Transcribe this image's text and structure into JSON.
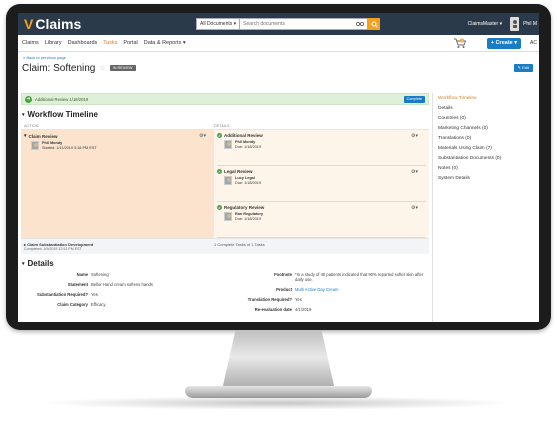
{
  "app": {
    "title": "Claims"
  },
  "search": {
    "scope": "All Documents ▾",
    "placeholder": "Search documents"
  },
  "user": {
    "name": "ClaimsMaster ▾",
    "short": "Phil M"
  },
  "nav": {
    "items": [
      "Claims",
      "Library",
      "Dashboards",
      "Tasks",
      "Portal",
      "Data & Reports ▾"
    ],
    "active_index": 3,
    "create_label": "+ Create ▾",
    "more": "AC",
    "cart_count": "0"
  },
  "page": {
    "back_link": "« Back to previous page",
    "title": "Claim: Softening",
    "star": "☆",
    "status": "IN REVIEW",
    "edit_label": "✎ Edit"
  },
  "alert": {
    "text": "Additional Review 1/18/2019",
    "button": "Complete"
  },
  "workflow": {
    "title": "Workflow Timeline",
    "columns": [
      "ACTION",
      "DETAILS"
    ],
    "action": {
      "title": "Claim Review",
      "person": "Phil Mondy",
      "meta": "Started: 1/11/2019 3:18 PM EST"
    },
    "tasks": [
      {
        "title": "Additional Review",
        "person": "Phil Mondy",
        "due": "Due: 1/18/2019"
      },
      {
        "title": "Legal Review",
        "person": "Lucy Legal",
        "due": "Due: 1/18/2019"
      },
      {
        "title": "Regulatory Review",
        "person": "Ran Regulatory",
        "due": "Due: 1/18/2019"
      }
    ],
    "substantiation": {
      "title": "▸ Claim Substantiation Development",
      "meta": "Completed: 1/9/2019 12:51 PM EST",
      "details": "1 Complete Tasks of 1 Tasks"
    }
  },
  "details": {
    "title": "Details",
    "left": [
      {
        "label": "Name",
        "value": "Softening"
      },
      {
        "label": "Statement",
        "value": "Bellor Hand cream softens hands"
      },
      {
        "label": "Substantiation Required?",
        "value": "Yes"
      },
      {
        "label": "Claim Category",
        "value": "Efficacy"
      }
    ],
    "right": [
      {
        "label": "Footnote",
        "value": "*In a study of 40 patients indicated that 90% reported softer skin after daily use."
      },
      {
        "label": "Product",
        "value": "Multi Active Day Cream"
      },
      {
        "label": "Translation Required?",
        "value": "Yes"
      },
      {
        "label": "Re-evaluation date",
        "value": "4/1/2019"
      }
    ]
  },
  "sidebar": {
    "items": [
      "Workflow Timeline",
      "Details",
      "Countries (0)",
      "Marketing Channels (0)",
      "Translations (0)",
      "Materials Using Claim (7)",
      "Substantiation Documents (0)",
      "Notes (0)",
      "System Details"
    ],
    "active_index": 0
  },
  "colors": {
    "topbar": "#2b3a4a",
    "accent_orange": "#f4a21b",
    "primary_blue": "#1a7cc4",
    "success_green": "#4aa544",
    "highlight": "#fbe3cd"
  }
}
